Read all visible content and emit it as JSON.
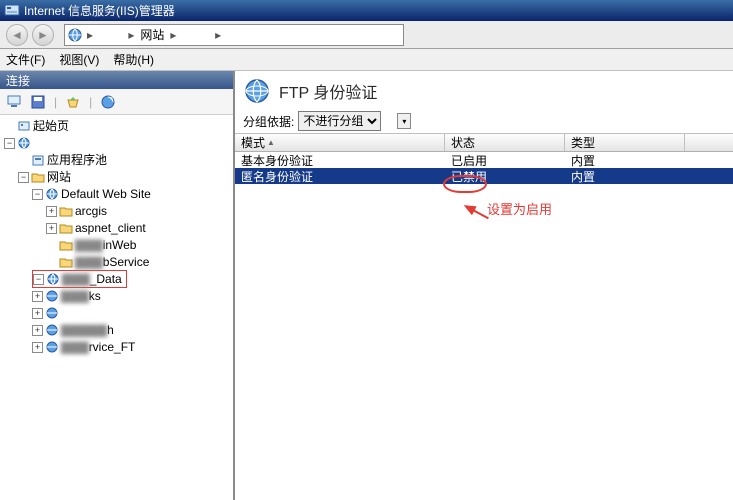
{
  "window": {
    "title": "Internet 信息服务(IIS)管理器"
  },
  "breadcrumb": {
    "node1": "       ",
    "node2": "网站",
    "node3": "        "
  },
  "menubar": {
    "file": "文件(F)",
    "view": "视图(V)",
    "help": "帮助(H)"
  },
  "sidebar": {
    "header": "连接",
    "tree": {
      "start": "起始页",
      "server": "      ",
      "app_pool": "应用程序池",
      "sites": "网站",
      "items": [
        {
          "label": "Default Web Site",
          "icon": "globe"
        },
        {
          "label": "arcgis",
          "icon": "folder"
        },
        {
          "label": "aspnet_client",
          "icon": "folder"
        },
        {
          "label": "inWeb",
          "icon": "folder",
          "blur": true
        },
        {
          "label": "bService",
          "icon": "folder",
          "blur": true
        },
        {
          "label": "_Data",
          "icon": "globe",
          "highlight": true,
          "blurPrefix": true
        },
        {
          "label": "ks",
          "icon": "globe",
          "blur": true
        },
        {
          "label": "",
          "icon": "globe",
          "blur": true
        },
        {
          "label": "h",
          "icon": "globe",
          "blur": true
        },
        {
          "label": "rvice_FT",
          "icon": "globe",
          "blur": true
        }
      ]
    }
  },
  "content": {
    "title": "FTP 身份验证",
    "group_by_label": "分组依据:",
    "group_by_value": "不进行分组",
    "columns": {
      "mode": "模式",
      "status": "状态",
      "type": "类型"
    },
    "rows": [
      {
        "mode": "基本身份验证",
        "status": "已启用",
        "type": "内置",
        "selected": false
      },
      {
        "mode": "匿名身份验证",
        "status": "已禁用",
        "type": "内置",
        "selected": true
      }
    ],
    "annotation": "设置为启用"
  }
}
